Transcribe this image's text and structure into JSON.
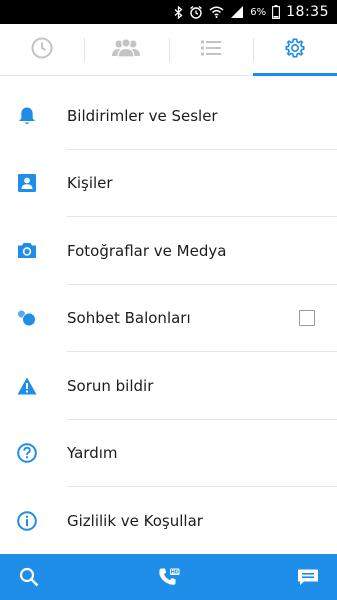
{
  "status_bar": {
    "battery_percent": "6%",
    "time": "18:35",
    "icons": [
      "bluetooth-icon",
      "alarm-icon",
      "wifi-icon",
      "signal-icon",
      "battery-icon"
    ]
  },
  "tabs": [
    {
      "name": "recent",
      "icon": "clock-icon",
      "active": false
    },
    {
      "name": "groups",
      "icon": "people-icon",
      "active": false
    },
    {
      "name": "list",
      "icon": "list-icon",
      "active": false
    },
    {
      "name": "settings",
      "icon": "gear-icon",
      "active": true
    }
  ],
  "menu": {
    "items": [
      {
        "label": "Bildirimler ve Sesler",
        "icon": "bell-icon"
      },
      {
        "label": "Kişiler",
        "icon": "contact-card-icon"
      },
      {
        "label": "Fotoğraflar ve Medya",
        "icon": "camera-icon"
      },
      {
        "label": "Sohbet Balonları",
        "icon": "chat-heads-icon",
        "checkbox": false
      },
      {
        "label": "Sorun bildir",
        "icon": "warning-icon"
      },
      {
        "label": "Yardım",
        "icon": "help-icon"
      },
      {
        "label": "Gizlilik ve Koşullar",
        "icon": "info-icon"
      }
    ]
  },
  "bottom_bar": {
    "buttons": [
      "search-icon",
      "phone-hd-icon",
      "compose-icon"
    ]
  },
  "colors": {
    "accent": "#1e8ee9",
    "tab_inactive": "#c4c4c4",
    "text": "#1c1c1c",
    "divider": "#e6e6e6"
  }
}
